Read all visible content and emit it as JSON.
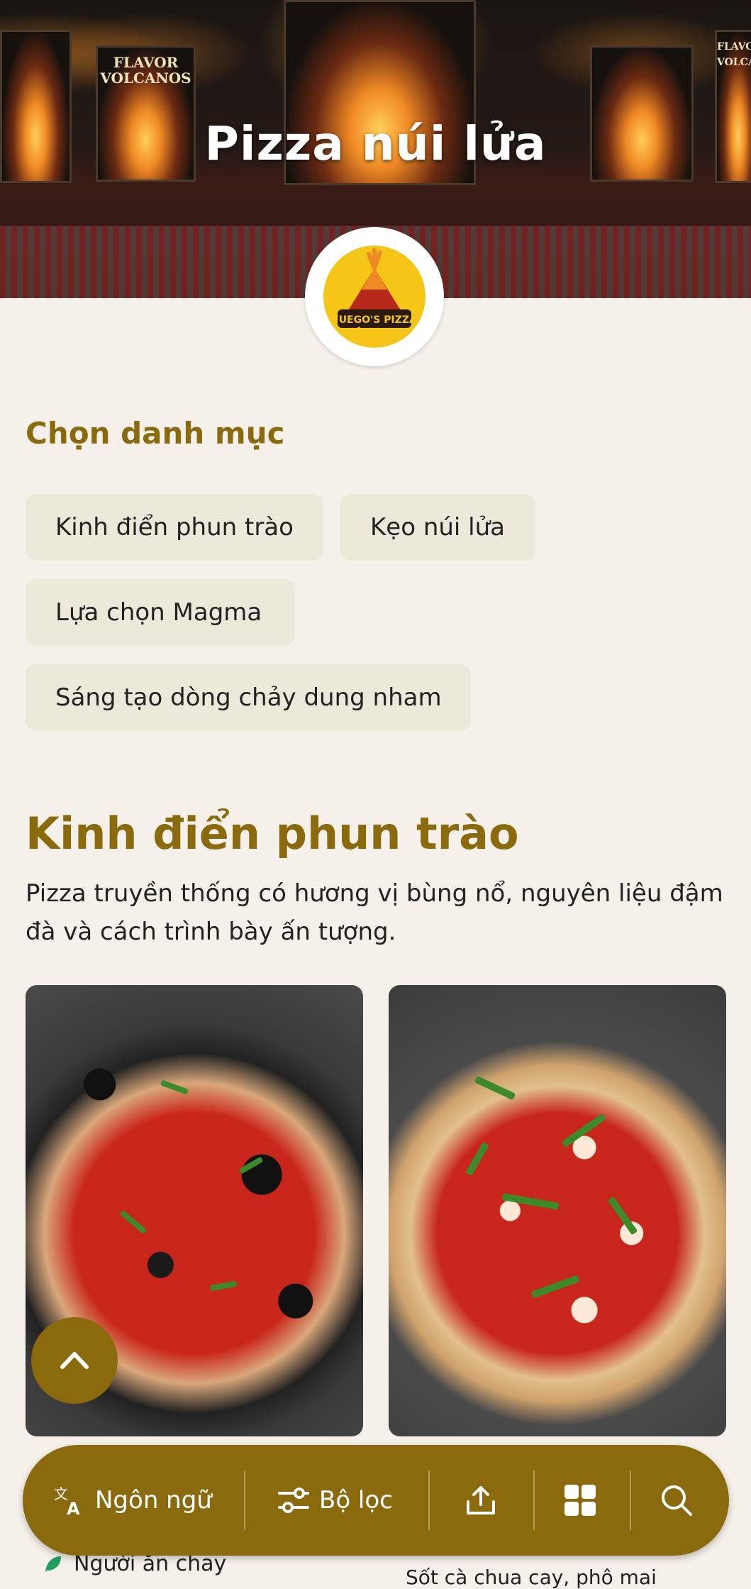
{
  "hero": {
    "title": "Pizza núi lửa",
    "poster_left_text": "FLAVOR VOLCANOS",
    "poster_right_text": "FLAVOR VOLCANO"
  },
  "logo": {
    "text": "FUEGO'S PIZZA"
  },
  "categories": {
    "label": "Chọn danh mục",
    "items": [
      "Kinh điển phun trào",
      "Kẹo núi lửa",
      "Lựa chọn Magma",
      "Sáng tạo dòng chảy dung nham"
    ]
  },
  "section": {
    "title": "Kinh điển phun trào",
    "description": "Pizza truyền thống có hương vị bùng nổ, nguyên liệu đậm đà và cách trình bày ấn tượng."
  },
  "cards": [
    {
      "tag": "Người ăn chay"
    },
    {
      "subtitle": "Sốt cà chua cay, phô mai"
    }
  ],
  "bottom_bar": {
    "language": "Ngôn ngữ",
    "filter": "Bộ lọc"
  },
  "colors": {
    "accent": "#8a6a0c",
    "background": "#f5f1ea",
    "chip": "#ece8da"
  }
}
